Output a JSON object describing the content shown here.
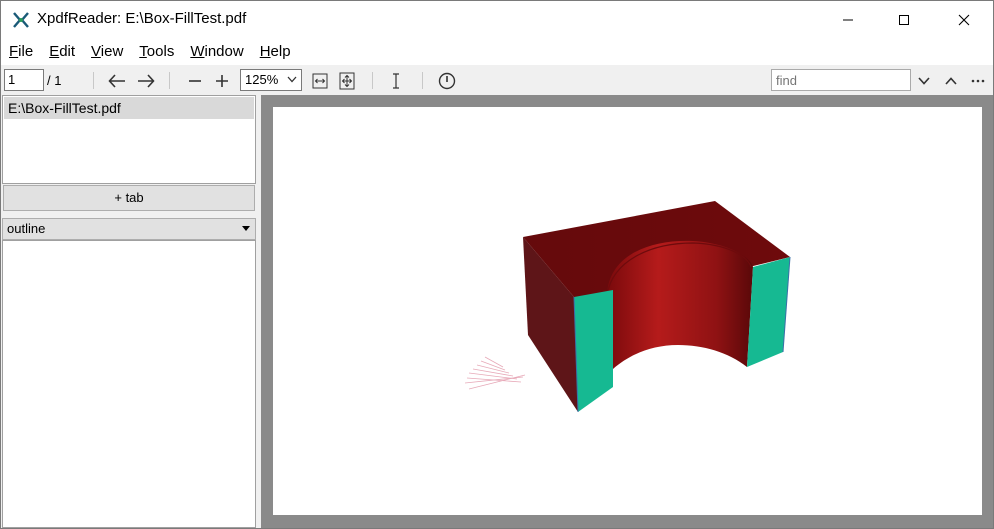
{
  "window": {
    "title": "XpdfReader: E:\\Box-FillTest.pdf"
  },
  "menu": [
    {
      "key": "F",
      "rest": "ile"
    },
    {
      "key": "E",
      "rest": "dit"
    },
    {
      "key": "V",
      "rest": "iew"
    },
    {
      "key": "T",
      "rest": "ools"
    },
    {
      "key": "W",
      "rest": "indow"
    },
    {
      "key": "H",
      "rest": "elp"
    }
  ],
  "toolbar": {
    "page_value": "1",
    "page_total": "/ 1",
    "zoom_value": "125%",
    "find_placeholder": "find",
    "icons": {
      "back": "arrow-left-icon",
      "forward": "arrow-right-icon",
      "zoom_out": "minus-icon",
      "zoom_in": "plus-icon",
      "fit_width": "fit-width-icon",
      "fit_page": "fit-page-icon",
      "select": "text-cursor-icon",
      "about": "about-icon",
      "find_next": "chevron-down-icon",
      "find_prev": "chevron-up-icon",
      "more": "more-icon"
    }
  },
  "sidebar": {
    "tabs": [
      "E:\\Box-FillTest.pdf"
    ],
    "add_tab_label": "+ tab",
    "outline_mode": "outline"
  },
  "colors": {
    "box_dark_red": "#6b0a0c",
    "box_side_red": "#5a1518",
    "inner_cylinder": "#a51a1a",
    "teal_face": "#16b992",
    "viewport_gray": "#8a8a8a"
  }
}
